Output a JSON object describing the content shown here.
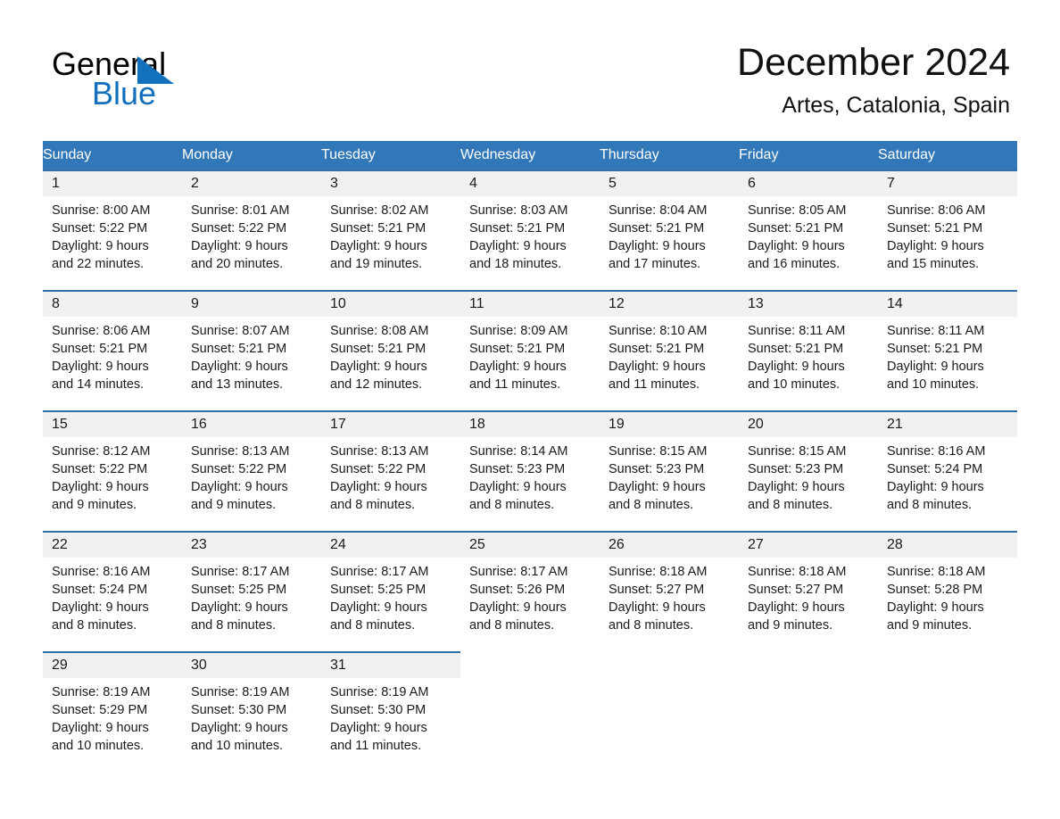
{
  "logo": {
    "word_black": "General",
    "word_blue": "Blue",
    "triangle_color": "#1270bd"
  },
  "header": {
    "month_title": "December 2024",
    "location": "Artes, Catalonia, Spain"
  },
  "theme": {
    "header_blue": "#3278b9",
    "row_rule_blue": "#2f6fab",
    "day_number_bg": "#f1f1f1",
    "text_color": "#1a1a1a",
    "page_bg": "#ffffff"
  },
  "weekday_headers": [
    "Sunday",
    "Monday",
    "Tuesday",
    "Wednesday",
    "Thursday",
    "Friday",
    "Saturday"
  ],
  "weeks": [
    [
      {
        "day": "1",
        "sunrise": "Sunrise: 8:00 AM",
        "sunset": "Sunset: 5:22 PM",
        "daylight_l1": "Daylight: 9 hours",
        "daylight_l2": "and 22 minutes."
      },
      {
        "day": "2",
        "sunrise": "Sunrise: 8:01 AM",
        "sunset": "Sunset: 5:22 PM",
        "daylight_l1": "Daylight: 9 hours",
        "daylight_l2": "and 20 minutes."
      },
      {
        "day": "3",
        "sunrise": "Sunrise: 8:02 AM",
        "sunset": "Sunset: 5:21 PM",
        "daylight_l1": "Daylight: 9 hours",
        "daylight_l2": "and 19 minutes."
      },
      {
        "day": "4",
        "sunrise": "Sunrise: 8:03 AM",
        "sunset": "Sunset: 5:21 PM",
        "daylight_l1": "Daylight: 9 hours",
        "daylight_l2": "and 18 minutes."
      },
      {
        "day": "5",
        "sunrise": "Sunrise: 8:04 AM",
        "sunset": "Sunset: 5:21 PM",
        "daylight_l1": "Daylight: 9 hours",
        "daylight_l2": "and 17 minutes."
      },
      {
        "day": "6",
        "sunrise": "Sunrise: 8:05 AM",
        "sunset": "Sunset: 5:21 PM",
        "daylight_l1": "Daylight: 9 hours",
        "daylight_l2": "and 16 minutes."
      },
      {
        "day": "7",
        "sunrise": "Sunrise: 8:06 AM",
        "sunset": "Sunset: 5:21 PM",
        "daylight_l1": "Daylight: 9 hours",
        "daylight_l2": "and 15 minutes."
      }
    ],
    [
      {
        "day": "8",
        "sunrise": "Sunrise: 8:06 AM",
        "sunset": "Sunset: 5:21 PM",
        "daylight_l1": "Daylight: 9 hours",
        "daylight_l2": "and 14 minutes."
      },
      {
        "day": "9",
        "sunrise": "Sunrise: 8:07 AM",
        "sunset": "Sunset: 5:21 PM",
        "daylight_l1": "Daylight: 9 hours",
        "daylight_l2": "and 13 minutes."
      },
      {
        "day": "10",
        "sunrise": "Sunrise: 8:08 AM",
        "sunset": "Sunset: 5:21 PM",
        "daylight_l1": "Daylight: 9 hours",
        "daylight_l2": "and 12 minutes."
      },
      {
        "day": "11",
        "sunrise": "Sunrise: 8:09 AM",
        "sunset": "Sunset: 5:21 PM",
        "daylight_l1": "Daylight: 9 hours",
        "daylight_l2": "and 11 minutes."
      },
      {
        "day": "12",
        "sunrise": "Sunrise: 8:10 AM",
        "sunset": "Sunset: 5:21 PM",
        "daylight_l1": "Daylight: 9 hours",
        "daylight_l2": "and 11 minutes."
      },
      {
        "day": "13",
        "sunrise": "Sunrise: 8:11 AM",
        "sunset": "Sunset: 5:21 PM",
        "daylight_l1": "Daylight: 9 hours",
        "daylight_l2": "and 10 minutes."
      },
      {
        "day": "14",
        "sunrise": "Sunrise: 8:11 AM",
        "sunset": "Sunset: 5:21 PM",
        "daylight_l1": "Daylight: 9 hours",
        "daylight_l2": "and 10 minutes."
      }
    ],
    [
      {
        "day": "15",
        "sunrise": "Sunrise: 8:12 AM",
        "sunset": "Sunset: 5:22 PM",
        "daylight_l1": "Daylight: 9 hours",
        "daylight_l2": "and 9 minutes."
      },
      {
        "day": "16",
        "sunrise": "Sunrise: 8:13 AM",
        "sunset": "Sunset: 5:22 PM",
        "daylight_l1": "Daylight: 9 hours",
        "daylight_l2": "and 9 minutes."
      },
      {
        "day": "17",
        "sunrise": "Sunrise: 8:13 AM",
        "sunset": "Sunset: 5:22 PM",
        "daylight_l1": "Daylight: 9 hours",
        "daylight_l2": "and 8 minutes."
      },
      {
        "day": "18",
        "sunrise": "Sunrise: 8:14 AM",
        "sunset": "Sunset: 5:23 PM",
        "daylight_l1": "Daylight: 9 hours",
        "daylight_l2": "and 8 minutes."
      },
      {
        "day": "19",
        "sunrise": "Sunrise: 8:15 AM",
        "sunset": "Sunset: 5:23 PM",
        "daylight_l1": "Daylight: 9 hours",
        "daylight_l2": "and 8 minutes."
      },
      {
        "day": "20",
        "sunrise": "Sunrise: 8:15 AM",
        "sunset": "Sunset: 5:23 PM",
        "daylight_l1": "Daylight: 9 hours",
        "daylight_l2": "and 8 minutes."
      },
      {
        "day": "21",
        "sunrise": "Sunrise: 8:16 AM",
        "sunset": "Sunset: 5:24 PM",
        "daylight_l1": "Daylight: 9 hours",
        "daylight_l2": "and 8 minutes."
      }
    ],
    [
      {
        "day": "22",
        "sunrise": "Sunrise: 8:16 AM",
        "sunset": "Sunset: 5:24 PM",
        "daylight_l1": "Daylight: 9 hours",
        "daylight_l2": "and 8 minutes."
      },
      {
        "day": "23",
        "sunrise": "Sunrise: 8:17 AM",
        "sunset": "Sunset: 5:25 PM",
        "daylight_l1": "Daylight: 9 hours",
        "daylight_l2": "and 8 minutes."
      },
      {
        "day": "24",
        "sunrise": "Sunrise: 8:17 AM",
        "sunset": "Sunset: 5:25 PM",
        "daylight_l1": "Daylight: 9 hours",
        "daylight_l2": "and 8 minutes."
      },
      {
        "day": "25",
        "sunrise": "Sunrise: 8:17 AM",
        "sunset": "Sunset: 5:26 PM",
        "daylight_l1": "Daylight: 9 hours",
        "daylight_l2": "and 8 minutes."
      },
      {
        "day": "26",
        "sunrise": "Sunrise: 8:18 AM",
        "sunset": "Sunset: 5:27 PM",
        "daylight_l1": "Daylight: 9 hours",
        "daylight_l2": "and 8 minutes."
      },
      {
        "day": "27",
        "sunrise": "Sunrise: 8:18 AM",
        "sunset": "Sunset: 5:27 PM",
        "daylight_l1": "Daylight: 9 hours",
        "daylight_l2": "and 9 minutes."
      },
      {
        "day": "28",
        "sunrise": "Sunrise: 8:18 AM",
        "sunset": "Sunset: 5:28 PM",
        "daylight_l1": "Daylight: 9 hours",
        "daylight_l2": "and 9 minutes."
      }
    ],
    [
      {
        "day": "29",
        "sunrise": "Sunrise: 8:19 AM",
        "sunset": "Sunset: 5:29 PM",
        "daylight_l1": "Daylight: 9 hours",
        "daylight_l2": "and 10 minutes."
      },
      {
        "day": "30",
        "sunrise": "Sunrise: 8:19 AM",
        "sunset": "Sunset: 5:30 PM",
        "daylight_l1": "Daylight: 9 hours",
        "daylight_l2": "and 10 minutes."
      },
      {
        "day": "31",
        "sunrise": "Sunrise: 8:19 AM",
        "sunset": "Sunset: 5:30 PM",
        "daylight_l1": "Daylight: 9 hours",
        "daylight_l2": "and 11 minutes."
      },
      {
        "day": "",
        "sunrise": "",
        "sunset": "",
        "daylight_l1": "",
        "daylight_l2": ""
      },
      {
        "day": "",
        "sunrise": "",
        "sunset": "",
        "daylight_l1": "",
        "daylight_l2": ""
      },
      {
        "day": "",
        "sunrise": "",
        "sunset": "",
        "daylight_l1": "",
        "daylight_l2": ""
      },
      {
        "day": "",
        "sunrise": "",
        "sunset": "",
        "daylight_l1": "",
        "daylight_l2": ""
      }
    ]
  ]
}
